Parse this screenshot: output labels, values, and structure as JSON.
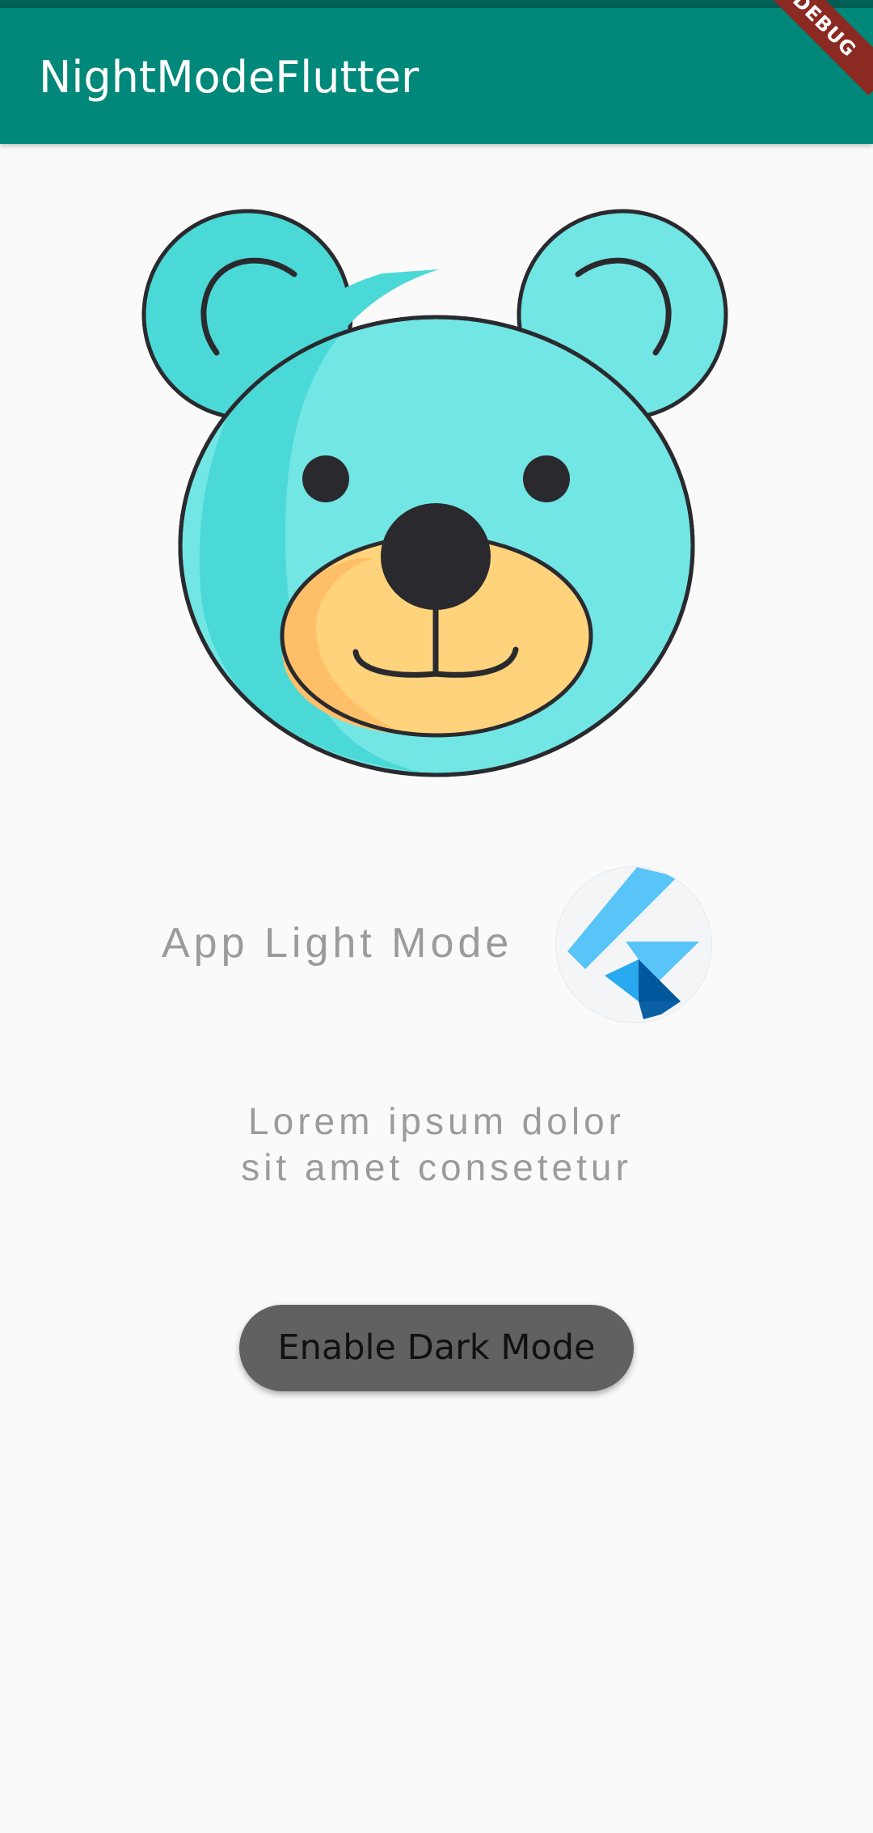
{
  "app_bar": {
    "title": "NightModeFlutter",
    "debug_banner": "DEBUG"
  },
  "colors": {
    "app_bar": "#00887a",
    "background": "#fafafa",
    "bear_face": "#72e6e4",
    "bear_shadow": "#4bd9d7",
    "bear_muzzle": "#ffd37b",
    "button_bg": "#616161"
  },
  "main": {
    "illustration": "bear-icon",
    "mode_label": "App Light Mode",
    "logo": "flutter-logo-icon",
    "lorem_line_1": "Lorem ipsum dolor",
    "lorem_line_2": "sit amet consetetur",
    "button_label": "Enable Dark Mode"
  }
}
